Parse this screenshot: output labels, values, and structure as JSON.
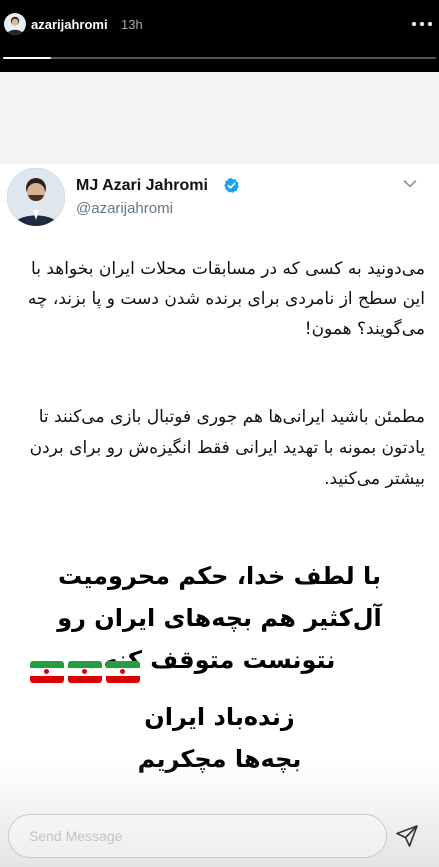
{
  "story_header": {
    "username": "azarijahromi",
    "time": "13h",
    "progress": 0.11
  },
  "tweet": {
    "display_name": "MJ Azari Jahromi",
    "handle": "@azarijahromi",
    "verified": true,
    "paragraph1": "می‌دونید به کسی که در مسابقات محلات ایران بخواهد با این سطح از نامردی برای برنده شدن دست و پا بزند، چه می‌گویند؟ همون!",
    "paragraph2": "مطمئن باشید ایرانی‌ها هم جوری فوتبال بازی می‌کنند تا یادتون بمونه با تهدید ایرانی فقط انگیزه‌ش رو برای بردن بیشتر می‌کنید."
  },
  "caption": {
    "line1": "با لطف خدا، حکم محرومیت",
    "line2": "آل‌کثیر هم بچه‌های ایران رو",
    "line3": "نتونست متوقف کنه",
    "line4": "زنده‌باد ایران",
    "line5": "بچه‌ها مچکریم",
    "flag_emoji": "🇮🇷"
  },
  "message_bar": {
    "placeholder": "Send Message"
  },
  "icons": {
    "more": "more-icon",
    "verified": "verified-icon",
    "chevron": "chevron-down-icon",
    "send": "send-icon"
  },
  "colors": {
    "verified_blue": "#1da1f2",
    "handle_gray": "#657786",
    "progress_track": "#555555",
    "progress_fill": "#ffffff"
  }
}
